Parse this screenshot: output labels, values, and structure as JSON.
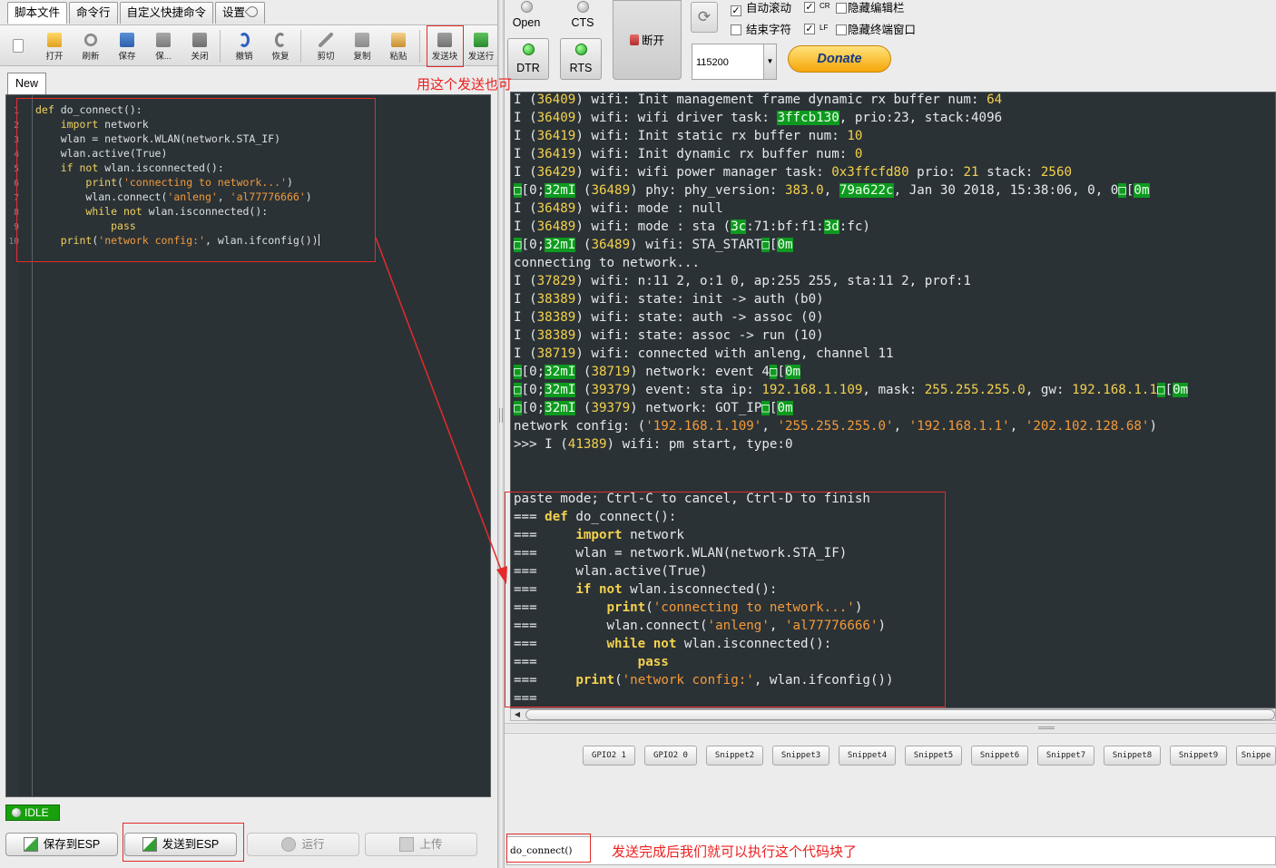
{
  "menu_tabs": [
    "脚本文件",
    "命令行",
    "自定义快捷命令",
    "设置"
  ],
  "toolbar": {
    "open": "打开",
    "refresh": "刷新",
    "save": "保存",
    "save_as": "保...",
    "close": "关闭",
    "undo": "撤销",
    "redo": "恢复",
    "cut": "剪切",
    "copy": "复制",
    "paste": "粘贴",
    "send_block": "发送块",
    "send_line": "发送行"
  },
  "file_tab": "New",
  "editor_lines": [
    {
      "n": "1",
      "code": "def do_connect():"
    },
    {
      "n": "2",
      "code": "    import network"
    },
    {
      "n": "3",
      "code": "    wlan = network.WLAN(network.STA_IF)"
    },
    {
      "n": "4",
      "code": "    wlan.active(True)"
    },
    {
      "n": "5",
      "code": "    if not wlan.isconnected():"
    },
    {
      "n": "6",
      "code": "        print('connecting to network...')"
    },
    {
      "n": "7",
      "code": "        wlan.connect('anleng', 'al77776666')"
    },
    {
      "n": "8",
      "code": "        while not wlan.isconnected():"
    },
    {
      "n": "9",
      "code": "            pass"
    },
    {
      "n": "10",
      "code": "    print('network config:', wlan.ifconfig())"
    }
  ],
  "status": "IDLE",
  "buttons": {
    "save_esp": "保存到ESP",
    "send_esp": "发送到ESP",
    "run": "运行",
    "upload": "上传"
  },
  "annotations": {
    "send_block_hint": "用这个发送也可",
    "after_send_hint": "发送完成后我们就可以执行这个代码块了"
  },
  "serial": {
    "open": "Open",
    "cts": "CTS",
    "dtr": "DTR",
    "rts": "RTS",
    "disconnect": "断开",
    "auto_scroll": "自动滚动",
    "cr": "CR",
    "hide_editor": "隐藏编辑栏",
    "end_char": "结束字符",
    "lf": "LF",
    "hide_terminal": "隐藏终端窗口",
    "baud": "115200",
    "donate": "Donate"
  },
  "terminal_lines": [
    "I (36409) wifi: Init management frame dynamic rx buffer num: 64",
    "I (36409) wifi: wifi driver task: 3ffcb130, prio:23, stack:4096",
    "I (36419) wifi: Init static rx buffer num: 10",
    "I (36419) wifi: Init dynamic rx buffer num: 0",
    "I (36429) wifi: wifi power manager task: 0x3ffcfd80 prio: 21 stack: 2560",
    "\u001b[0;32mI (36489) phy: phy_version: 383.0, 79a622c, Jan 30 2018, 15:38:06, 0, 0\u001b[0m",
    "I (36489) wifi: mode : null",
    "I (36489) wifi: mode : sta (3c:71:bf:f1:3d:fc)",
    "\u001b[0;32mI (36489) wifi: STA_START\u001b[0m",
    "connecting to network...",
    "I (37829) wifi: n:11 2, o:1 0, ap:255 255, sta:11 2, prof:1",
    "I (38389) wifi: state: init -> auth (b0)",
    "I (38389) wifi: state: auth -> assoc (0)",
    "I (38389) wifi: state: assoc -> run (10)",
    "I (38719) wifi: connected with anleng, channel 11",
    "\u001b[0;32mI (38719) network: event 4\u001b[0m",
    "\u001b[0;32mI (39379) event: sta ip: 192.168.1.109, mask: 255.255.255.0, gw: 192.168.1.1\u001b[0m",
    "\u001b[0;32mI (39379) network: GOT_IP\u001b[0m",
    "network config: ('192.168.1.109', '255.255.255.0', '192.168.1.1', '202.102.128.68')",
    ">>> I (41389) wifi: pm start, type:0",
    "",
    "",
    "paste mode; Ctrl-C to cancel, Ctrl-D to finish",
    "=== def do_connect():",
    "===     import network",
    "===     wlan = network.WLAN(network.STA_IF)",
    "===     wlan.active(True)",
    "===     if not wlan.isconnected():",
    "===         print('connecting to network...')",
    "===         wlan.connect('anleng', 'al77776666')",
    "===         while not wlan.isconnected():",
    "===             pass",
    "===     print('network config:', wlan.ifconfig())",
    "==="
  ],
  "snippets": [
    "GPIO2 1",
    "GPIO2 0",
    "Snippet2",
    "Snippet3",
    "Snippet4",
    "Snippet5",
    "Snippet6",
    "Snippet7",
    "Snippet8",
    "Snippet9",
    "Snippe"
  ],
  "command_input": "do_connect()"
}
